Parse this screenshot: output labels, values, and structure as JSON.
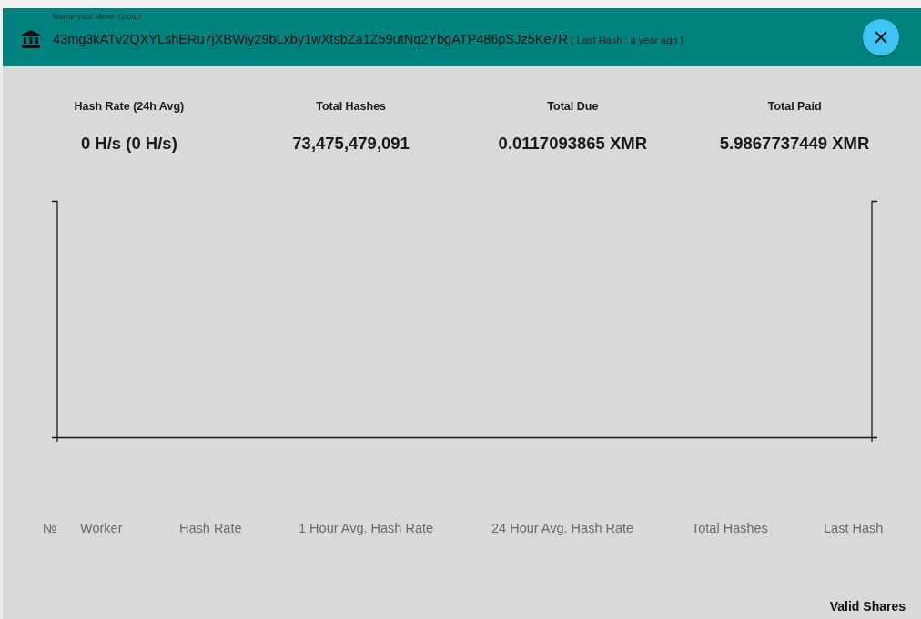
{
  "header": {
    "field_label": "Name your Miner Group",
    "group_name": "43mg3kATv2QXYLshERu7jXBWiy29bLxby1wXtsbZa1Z59utNq2YbgATP486pSJz5Ke7R",
    "last_hash_note": "( Last Hash : a year ago )"
  },
  "stats": [
    {
      "label": "Hash Rate (24h Avg)",
      "value": "0 H/s (0 H/s)"
    },
    {
      "label": "Total Hashes",
      "value": "73,475,479,091"
    },
    {
      "label": "Total Due",
      "value": "0.0117093865 XMR"
    },
    {
      "label": "Total Paid",
      "value": "5.9867737449 XMR"
    }
  ],
  "table": {
    "columns": [
      "№",
      "Worker",
      "Hash Rate",
      "1 Hour Avg. Hash Rate",
      "24 Hour Avg. Hash Rate",
      "Total Hashes",
      "Last Hash"
    ],
    "overflow_column": "Valid Shares"
  }
}
